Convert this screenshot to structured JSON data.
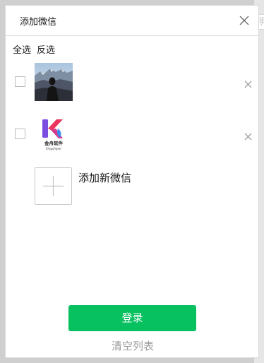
{
  "dialog": {
    "title": "添加微信",
    "close_icon": "close-icon"
  },
  "selection": {
    "select_all": "全选",
    "invert": "反选"
  },
  "accounts": [
    {
      "avatar": "mountain-silhouette-photo",
      "checked": false
    },
    {
      "avatar": "kingshiper-logo",
      "logo_text": "金舟软件",
      "logo_subtext": "Kingshiper",
      "checked": false
    }
  ],
  "add": {
    "label": "添加新微信",
    "icon": "plus-icon"
  },
  "actions": {
    "login": "登录",
    "clear": "清空列表"
  },
  "colors": {
    "accent": "#07c160"
  }
}
